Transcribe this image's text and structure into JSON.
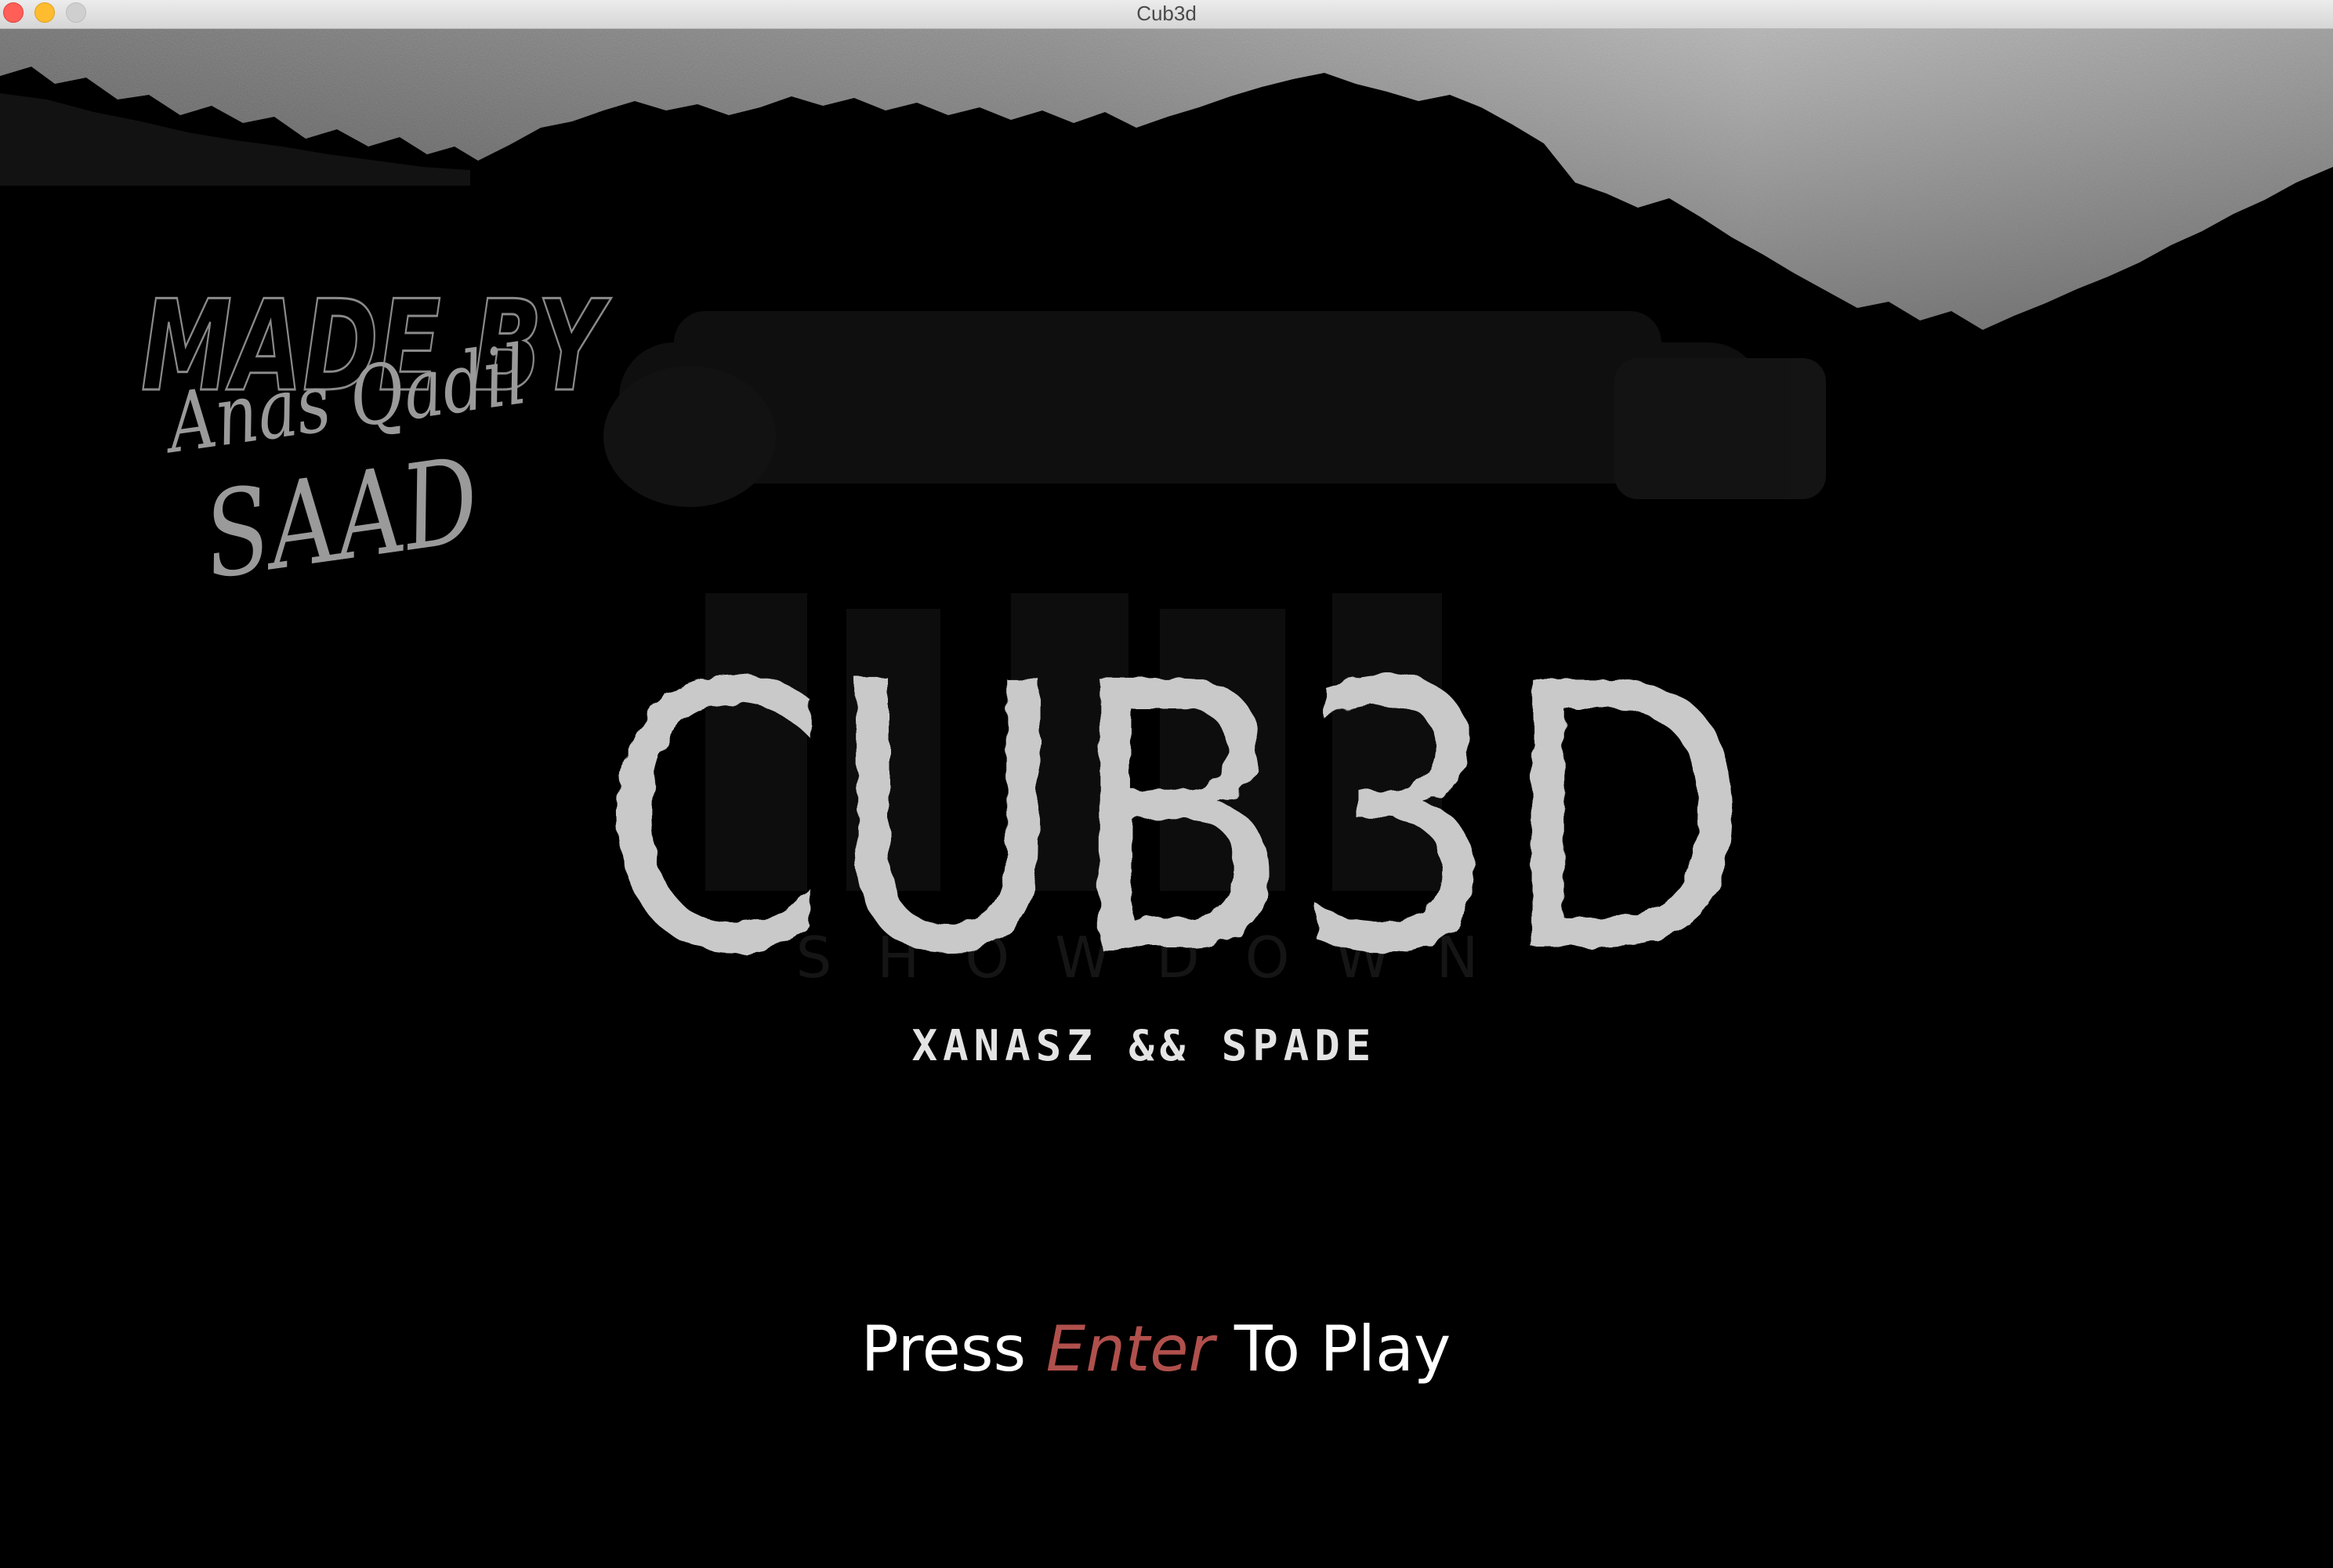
{
  "window": {
    "title": "Cub3d"
  },
  "credits": {
    "heading": "MADE BY",
    "names": [
      "Anas Qadil",
      "SAAD"
    ]
  },
  "logo": {
    "title": "CUB3D",
    "ghost_subtitle": "SHOWDOWN"
  },
  "authors": "XANASZ && SPADE",
  "prompt": {
    "before": "Press ",
    "key": "Enter",
    "after": " To Play"
  },
  "colors": {
    "background": "#000000",
    "logo_fill": "#c9c9c9",
    "prompt_text": "#ffffff",
    "prompt_key": "#b0504c",
    "credits_stroke": "#8a8a8a"
  },
  "icons": [
    "close-window-icon",
    "minimize-window-icon",
    "maximize-window-icon"
  ]
}
